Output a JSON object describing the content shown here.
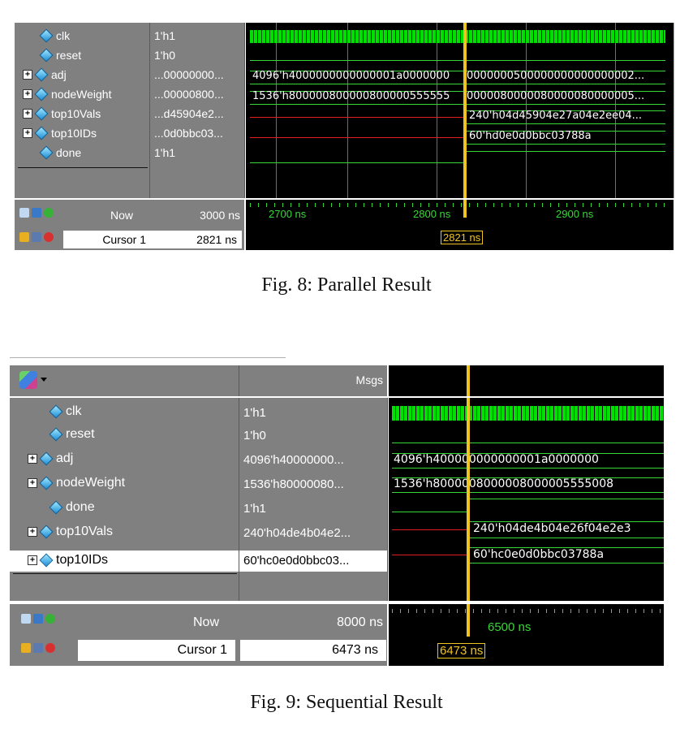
{
  "fig8": {
    "signals": [
      {
        "name": "clk",
        "value": "1'h1",
        "expandable": false
      },
      {
        "name": "reset",
        "value": "1'h0",
        "expandable": false
      },
      {
        "name": "adj",
        "value": "...00000000...",
        "expandable": true
      },
      {
        "name": "nodeWeight",
        "value": "...00000800...",
        "expandable": true
      },
      {
        "name": "top10Vals",
        "value": "...d45904e2...",
        "expandable": true
      },
      {
        "name": "top10IDs",
        "value": "...0d0bbc03...",
        "expandable": true
      },
      {
        "name": "done",
        "value": "1'h1",
        "expandable": false
      }
    ],
    "wave_text": {
      "adj": "4096'h4000000000000001a0000000",
      "adj_right": "0000000500000000000000002...",
      "nodeWeight": "1536'h800000800000800000555555",
      "nodeWeight_right": "0000080000080000080000005...",
      "top10Vals": "240'h04d45904e27a04e2ee04...",
      "top10IDs": "60'hd0e0d0bbc03788a"
    },
    "status": {
      "now_label": "Now",
      "now_value": "3000 ns",
      "cursor_label": "Cursor 1",
      "cursor_value": "2821 ns"
    },
    "timeline": [
      "2700 ns",
      "2800 ns",
      "2900 ns"
    ],
    "cursor_box": "2821 ns",
    "caption": "Fig. 8: Parallel Result"
  },
  "fig9": {
    "header_msgs": "Msgs",
    "signals": [
      {
        "name": "clk",
        "value": "1'h1",
        "expandable": false
      },
      {
        "name": "reset",
        "value": "1'h0",
        "expandable": false
      },
      {
        "name": "adj",
        "value": "4096'h40000000...",
        "expandable": true
      },
      {
        "name": "nodeWeight",
        "value": "1536'h80000080...",
        "expandable": true
      },
      {
        "name": "done",
        "value": "1'h1",
        "expandable": false
      },
      {
        "name": "top10Vals",
        "value": "240'h04de4b04e2...",
        "expandable": true
      },
      {
        "name": "top10IDs",
        "value": "60'hc0e0d0bbc03...",
        "expandable": true
      }
    ],
    "wave_text": {
      "adj": "4096'h400000000000001a0000000",
      "nodeWeight": "1536'h8000008000008000005555008",
      "top10Vals": "240'h04de4b04e26f04e2e3",
      "top10IDs": "60'hc0e0d0bbc03788a"
    },
    "status": {
      "now_label": "Now",
      "now_value": "8000 ns",
      "cursor_label": "Cursor 1",
      "cursor_value": "6473 ns"
    },
    "timeline": [
      "6500 ns"
    ],
    "cursor_box": "6473 ns",
    "caption": "Fig. 9: Sequential Result"
  },
  "colors": {
    "wave_bg": "#000000",
    "panel_gray": "#808080",
    "signal_green": "#39d639",
    "signal_red": "#e02020",
    "cursor_yellow": "#f0c420"
  },
  "icons": [
    "diamond-signal-icon",
    "expand-plus-icon",
    "zoom-icon",
    "lock-icon",
    "add-cursor-icon",
    "remove-cursor-icon",
    "wave-toolbar-icon"
  ]
}
